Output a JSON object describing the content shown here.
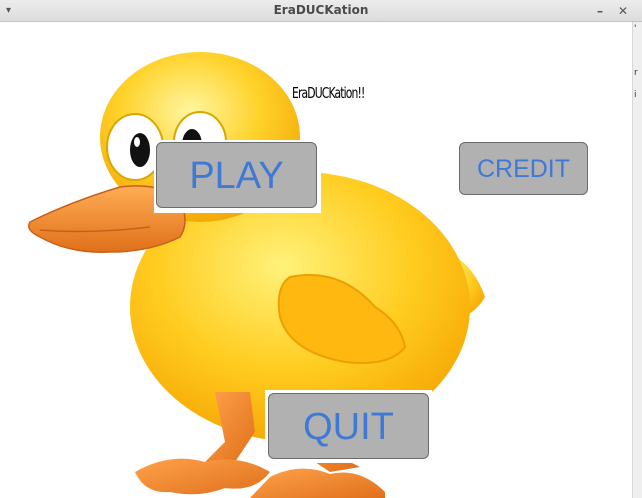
{
  "window": {
    "title": "EraDUCKation",
    "menu_glyph": "▾",
    "minimize_glyph": "–",
    "maximize_glyph": "✕"
  },
  "side_strip": {
    "glyphs": [
      "'",
      "r",
      "i"
    ]
  },
  "main": {
    "heading": "EraDUCKation!!",
    "play_label": "PLAY",
    "credit_label": "CREDIT",
    "quit_label": "QUIT"
  },
  "colors": {
    "button_text": "#3f79d6",
    "button_bg": "#b1b1b1",
    "duck_yellow": "#ffc91a",
    "duck_beak": "#f08a2a"
  },
  "icons": {
    "mascot": "duck-illustration"
  }
}
